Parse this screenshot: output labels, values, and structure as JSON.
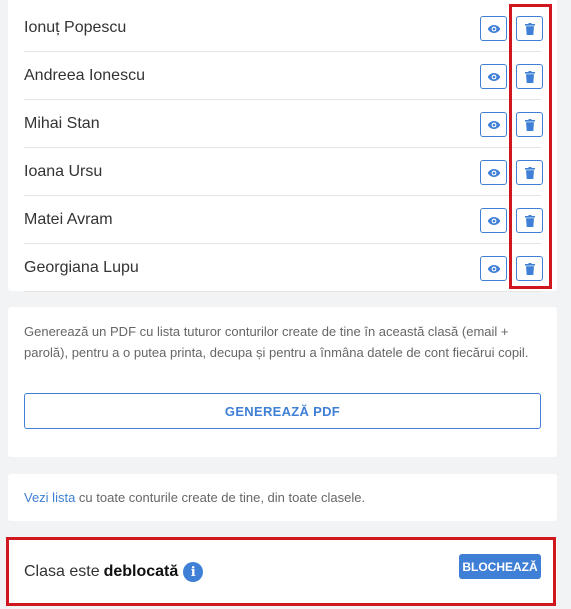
{
  "students": [
    {
      "name": "Ionuț Popescu"
    },
    {
      "name": "Andreea Ionescu"
    },
    {
      "name": "Mihai Stan"
    },
    {
      "name": "Ioana Ursu"
    },
    {
      "name": "Matei Avram"
    },
    {
      "name": "Georgiana Lupu"
    }
  ],
  "row_actions": {
    "view_icon": "eye-icon",
    "delete_icon": "trash-icon"
  },
  "pdf": {
    "description": "Generează un PDF cu lista tuturor conturilor create de tine în această clasă (email + parolă), pentru a o putea printa, decupa și pentru a înmâna datele de cont fiecărui copil.",
    "button_label": "GENEREAZĂ PDF"
  },
  "accounts_list": {
    "link_text": "Vezi lista",
    "rest_text": " cu toate conturile create de tine, din toate clasele."
  },
  "class_lock": {
    "text_prefix": "Clasa este",
    "status": "deblocată",
    "info_glyph": "i",
    "button_label": "BLOCHEAZĂ"
  },
  "colors": {
    "accent": "#3f7fd6",
    "highlight": "#d0161e"
  }
}
